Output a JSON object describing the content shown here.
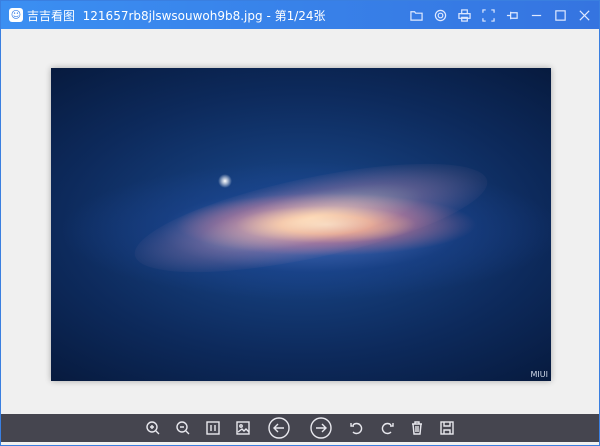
{
  "app": {
    "name": "吉吉看图",
    "filename": "121657rb8jlswsouwoh9b8.jpg",
    "separator": " - ",
    "counter": "第1/24张"
  },
  "window_controls": [
    "folder-icon",
    "settings-icon",
    "print-icon",
    "fullscreen-icon",
    "pin-icon",
    "minimize-icon",
    "maximize-icon",
    "close-icon"
  ],
  "image": {
    "watermark": "MIUI"
  },
  "toolbar": [
    "zoom-in",
    "zoom-out",
    "actual-size",
    "fit-image",
    "previous",
    "next",
    "rotate-left",
    "rotate-right",
    "delete",
    "save"
  ]
}
